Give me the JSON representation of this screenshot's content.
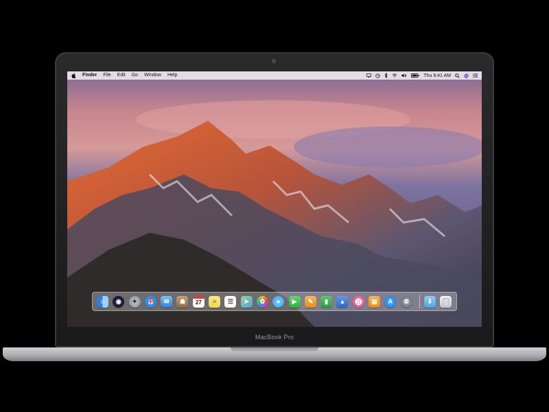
{
  "device": {
    "model_label": "MacBook Pro"
  },
  "menubar": {
    "items": [
      "Finder",
      "File",
      "Edit",
      "Go",
      "Window",
      "Help"
    ],
    "clock": "Thu 9:41 AM",
    "status_icons": [
      "airplay-icon",
      "time-machine-icon",
      "bluetooth-icon",
      "wifi-icon",
      "volume-icon",
      "battery-icon",
      "spotlight-icon",
      "siri-icon",
      "notification-center-icon"
    ]
  },
  "dock": {
    "apps": [
      {
        "name": "finder",
        "glyph": "☺",
        "color": "#3b8fe6"
      },
      {
        "name": "siri",
        "glyph": "◉",
        "color": "#5a3fc2"
      },
      {
        "name": "launchpad",
        "glyph": "✦",
        "color": "#8a8f99"
      },
      {
        "name": "safari",
        "glyph": "✣",
        "color": "#2f8fe8"
      },
      {
        "name": "mail",
        "glyph": "✉",
        "color": "#4a9de8"
      },
      {
        "name": "contacts",
        "glyph": "☗",
        "color": "#b8875a"
      },
      {
        "name": "calendar",
        "glyph": "27",
        "color": "#ffffff"
      },
      {
        "name": "notes",
        "glyph": "≡",
        "color": "#f5e27a"
      },
      {
        "name": "reminders",
        "glyph": "☰",
        "color": "#f7f7f7"
      },
      {
        "name": "maps",
        "glyph": "➤",
        "color": "#6cc26b"
      },
      {
        "name": "photos",
        "glyph": "✿",
        "color": "#f2f2f2"
      },
      {
        "name": "messages",
        "glyph": "●",
        "color": "#46b6f5"
      },
      {
        "name": "facetime",
        "glyph": "▶",
        "color": "#39c44a"
      },
      {
        "name": "pages",
        "glyph": "✎",
        "color": "#f0a23a"
      },
      {
        "name": "numbers",
        "glyph": "▮",
        "color": "#39a84e"
      },
      {
        "name": "keynote",
        "glyph": "▲",
        "color": "#3a7bd5"
      },
      {
        "name": "itunes",
        "glyph": "♫",
        "color": "#f35f9c"
      },
      {
        "name": "ibooks",
        "glyph": "▤",
        "color": "#f29a25"
      },
      {
        "name": "app-store",
        "glyph": "A",
        "color": "#2d8ef0"
      },
      {
        "name": "system-preferences",
        "glyph": "⚙",
        "color": "#7d8088"
      }
    ],
    "trailing": [
      {
        "name": "downloads-folder",
        "glyph": "⬇",
        "color": "#5fb3e8"
      },
      {
        "name": "trash",
        "glyph": "🗑",
        "color": "#d9dde2"
      }
    ],
    "calendar_day": "27"
  }
}
